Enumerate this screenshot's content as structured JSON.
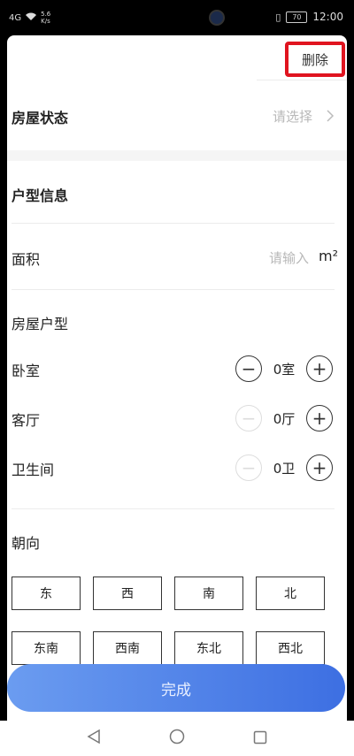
{
  "statusbar": {
    "signal": "4G",
    "speed": "5.6\nK/s",
    "battery": "70",
    "time": "12:00"
  },
  "header": {
    "delete_label": "删除"
  },
  "house_status": {
    "label": "房屋状态",
    "placeholder": "请选择"
  },
  "layout_section": {
    "title": "户型信息"
  },
  "area": {
    "label": "面积",
    "placeholder": "请输入",
    "unit": "m²"
  },
  "house_type": {
    "label": "房屋户型",
    "rows": [
      {
        "label": "卧室",
        "value": "0室",
        "minus_enabled": true
      },
      {
        "label": "客厅",
        "value": "0厅",
        "minus_enabled": false
      },
      {
        "label": "卫生间",
        "value": "0卫",
        "minus_enabled": false
      }
    ]
  },
  "orientation": {
    "label": "朝向",
    "options": [
      "东",
      "西",
      "南",
      "北",
      "东南",
      "西南",
      "东北",
      "西北"
    ]
  },
  "footer": {
    "finish_label": "完成"
  },
  "icons": {
    "chevron": "chevron-right-icon",
    "minus": "minus-circle-icon",
    "plus": "plus-circle-icon",
    "nav_back": "triangle-back-icon",
    "nav_home": "circle-home-icon",
    "nav_recent": "square-recent-icon"
  },
  "colors": {
    "highlight": "#e0141f",
    "primary_start": "#6b9cf0",
    "primary_end": "#3d6fe2"
  }
}
